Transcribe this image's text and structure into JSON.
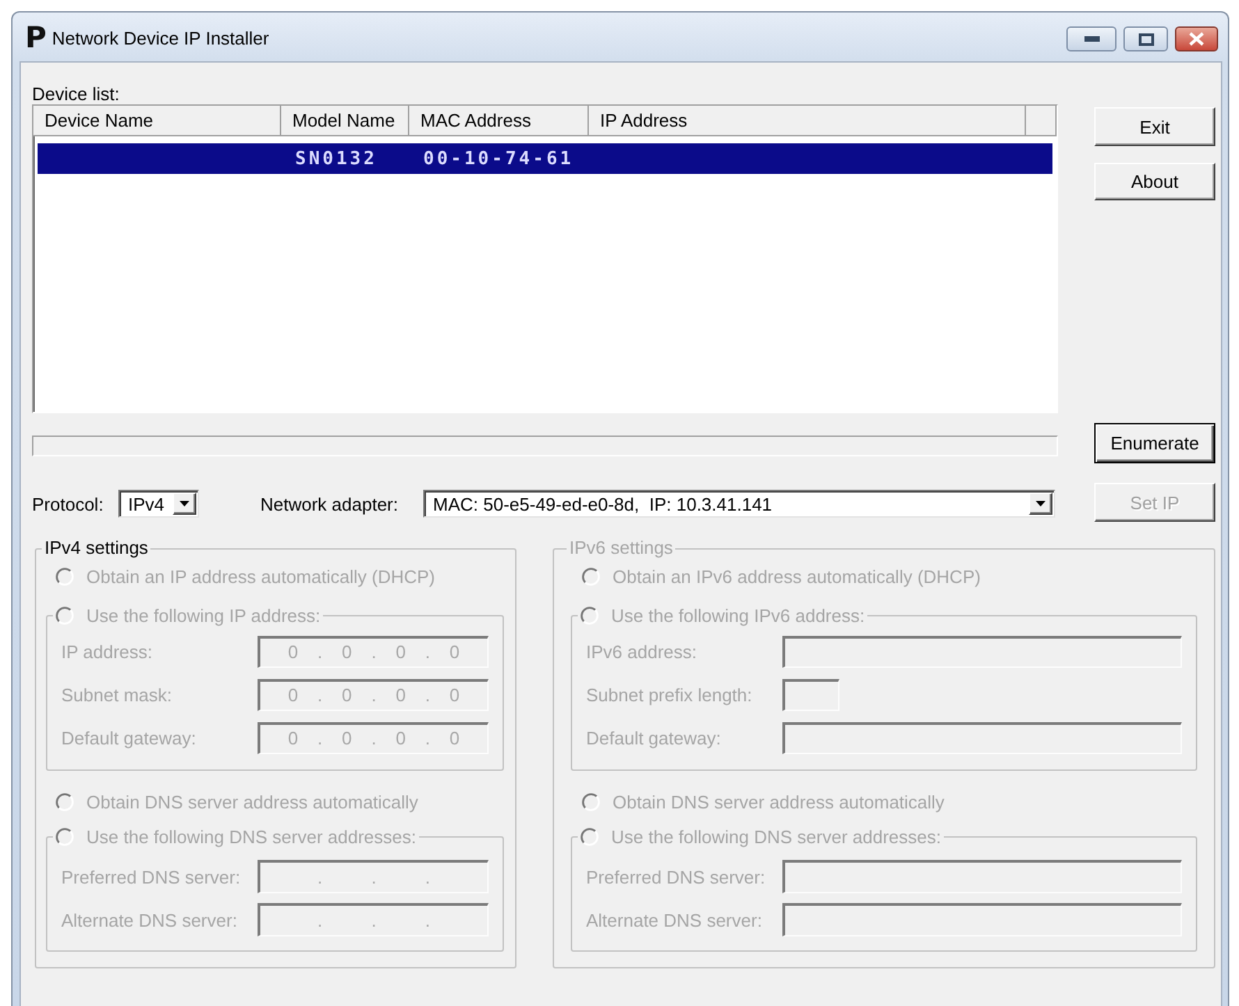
{
  "window": {
    "logo": "P",
    "title": "Network Device IP Installer"
  },
  "device_list": {
    "label": "Device list:",
    "columns": [
      "Device Name",
      "Model Name",
      "MAC Address",
      "IP Address"
    ],
    "rows": [
      {
        "model_name": "SN0132",
        "mac_address": "00-10-74-61",
        "selected": true
      }
    ]
  },
  "exit_button": {
    "label": "Exit",
    "disabled": false
  },
  "about_button": {
    "label": "About",
    "disabled": false
  },
  "progress": {
    "level": 0
  },
  "enumerate_button": {
    "label": "Enumerate",
    "disabled": false,
    "default": true
  },
  "protocol": {
    "label": "Protocol:",
    "value": "IPv4"
  },
  "network_adapter": {
    "label": "Network adapter:",
    "value": "MAC: 50-e5-49-ed-e0-8d,  IP: 10.3.41.141"
  },
  "set_ip_button": {
    "label": "Set IP",
    "disabled": true
  },
  "ipv4_settings": {
    "title": "IPv4 settings",
    "disabled": false,
    "address": {
      "auto": {
        "label": "Obtain an IP address automatically (DHCP)",
        "checked": false,
        "disabled": true
      },
      "manual": {
        "label": "Use the following IP address:",
        "checked": false,
        "disabled": true
      },
      "fields": [
        {
          "label": "IP address:",
          "kind": "ip",
          "octets": [
            "0",
            "0",
            "0",
            "0"
          ],
          "separators": [
            ".",
            ".",
            "."
          ],
          "disabled": true
        },
        {
          "label": "Subnet mask:",
          "kind": "ip",
          "octets": [
            "0",
            "0",
            "0",
            "0"
          ],
          "separators": [
            ".",
            ".",
            "."
          ],
          "disabled": true
        },
        {
          "label": "Default gateway:",
          "kind": "ip",
          "octets": [
            "0",
            "0",
            "0",
            "0"
          ],
          "separators": [
            ".",
            ".",
            "."
          ],
          "disabled": true
        }
      ]
    },
    "dns": {
      "auto": {
        "label": "Obtain DNS server address automatically",
        "checked": false,
        "disabled": true
      },
      "manual": {
        "label": "Use the following DNS server addresses:",
        "checked": false,
        "disabled": true
      },
      "fields": [
        {
          "label": "Preferred DNS server:",
          "kind": "ip",
          "separators": [
            ".",
            ".",
            "."
          ],
          "disabled": true
        },
        {
          "label": "Alternate DNS server:",
          "kind": "ip",
          "separators": [
            ".",
            ".",
            "."
          ],
          "disabled": true
        }
      ]
    }
  },
  "ipv6_settings": {
    "title": "IPv6 settings",
    "disabled": true,
    "address": {
      "auto": {
        "label": "Obtain an IPv6 address automatically (DHCP)",
        "checked": false,
        "disabled": true
      },
      "manual": {
        "label": "Use the following IPv6 address:",
        "checked": false,
        "disabled": true
      },
      "fields": [
        {
          "label": "IPv6 address:",
          "kind": "text",
          "disabled": true
        },
        {
          "label": "Subnet prefix length:",
          "kind": "number",
          "disabled": true
        },
        {
          "label": "Default gateway:",
          "kind": "text",
          "disabled": true
        }
      ]
    },
    "dns": {
      "auto": {
        "label": "Obtain DNS server address automatically",
        "checked": false,
        "disabled": true
      },
      "manual": {
        "label": "Use the following DNS server addresses:",
        "checked": false,
        "disabled": true
      },
      "fields": [
        {
          "label": "Preferred DNS server:",
          "kind": "text",
          "disabled": true
        },
        {
          "label": "Alternate DNS server:",
          "kind": "text",
          "disabled": true
        }
      ]
    }
  }
}
